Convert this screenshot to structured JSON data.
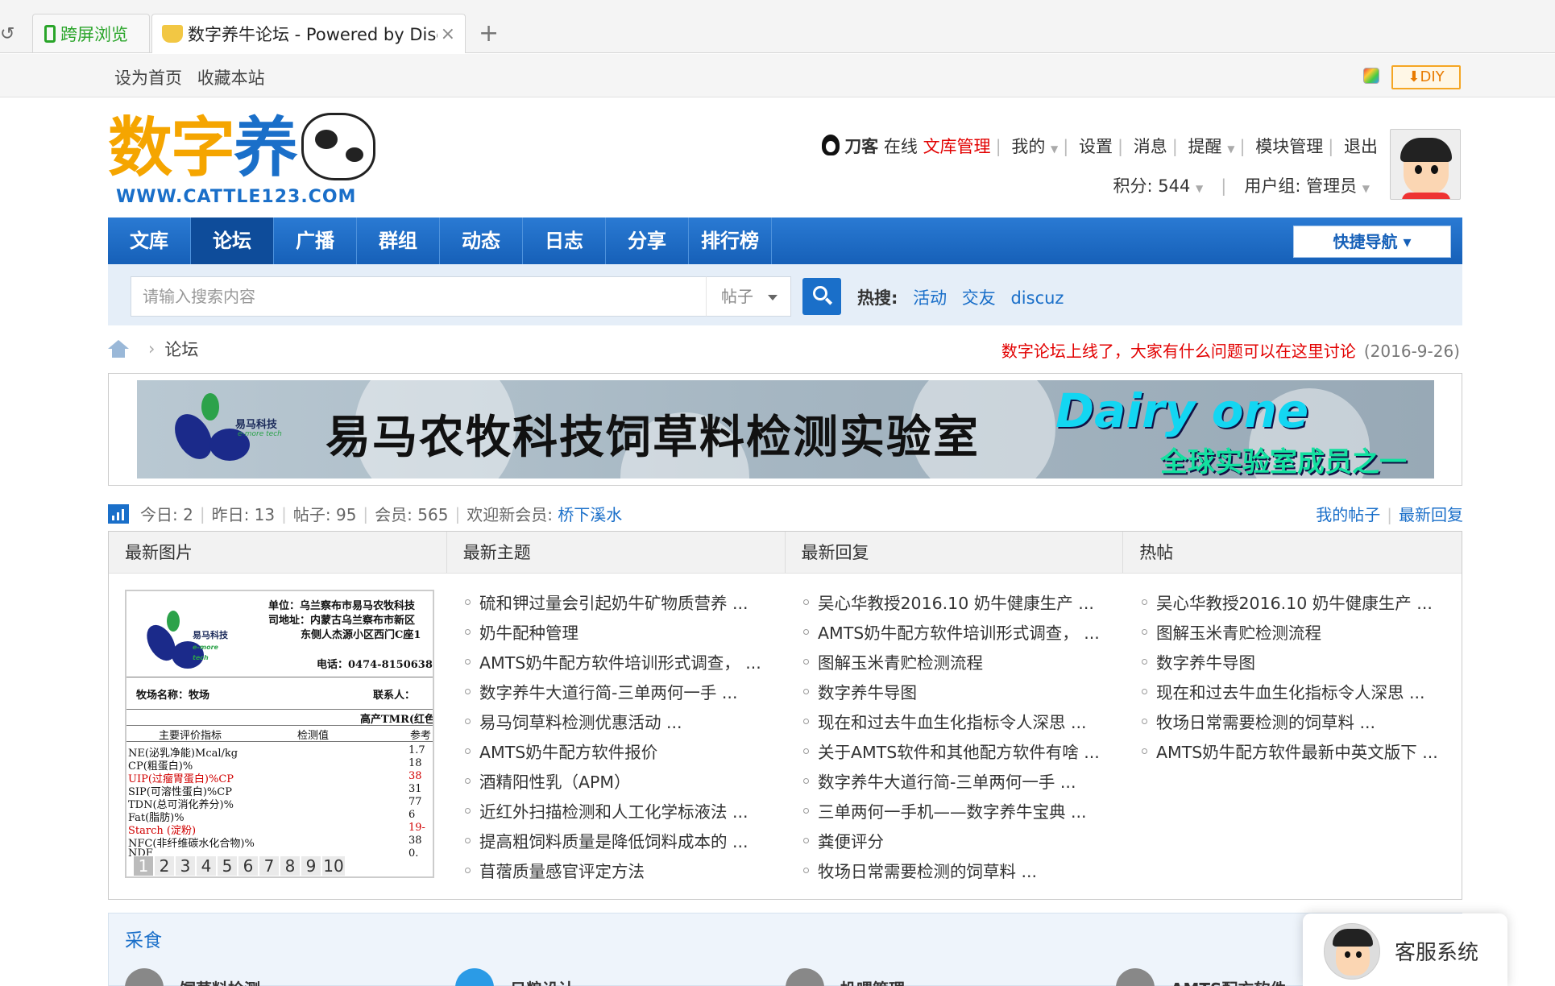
{
  "browser": {
    "tabs": [
      {
        "label": "跨屏浏览"
      },
      {
        "label": "数字养牛论坛 - Powered by Discuz!"
      }
    ]
  },
  "topbar": {
    "links": [
      "设为首页",
      "收藏本站"
    ],
    "diy": "DIY"
  },
  "logo": {
    "text1": "数字",
    "text2": "养",
    "url": "WWW.CATTLE123.COM"
  },
  "usernav": {
    "username": "刀客",
    "status": "在线",
    "items": [
      "文库管理",
      "我的",
      "设置",
      "消息",
      "提醒",
      "模块管理",
      "退出"
    ],
    "points_label": "积分: 544",
    "group_label": "用户组: 管理员"
  },
  "mainnav": {
    "items": [
      "文库",
      "论坛",
      "广播",
      "群组",
      "动态",
      "日志",
      "分享",
      "排行榜"
    ],
    "active": "论坛",
    "quicknav": "快捷导航"
  },
  "search": {
    "placeholder": "请输入搜索内容",
    "type": "帖子",
    "hot_label": "热搜:",
    "hot_keywords": [
      "活动",
      "交友",
      "discuz"
    ]
  },
  "breadcrumb": {
    "current": "论坛"
  },
  "notice": {
    "message": "数字论坛上线了，大家有什么问题可以在这里讨论",
    "date": "(2016-9-26)"
  },
  "banner": {
    "brand_small": "易马科技",
    "brand_tag": "e-more tech",
    "title": "易马农牧科技饲草料检测实验室",
    "dairy": "Dairy one",
    "sub": "全球实验室成员之一"
  },
  "stats": {
    "today": "今日: 2",
    "yesterday": "昨日: 13",
    "posts": "帖子: 95",
    "members": "会员: 565",
    "welcome": "欢迎新会员:",
    "new_member": "桥下溪水",
    "my_posts": "我的帖子",
    "latest_reply": "最新回复"
  },
  "columns": {
    "headers": [
      "最新图片",
      "最新主题",
      "最新回复",
      "热帖"
    ],
    "latest_topics": [
      "硫和钾过量会引起奶牛矿物质营养 ...",
      "奶牛配种管理",
      "AMTS奶牛配方软件培训形式调查， ...",
      "数字养牛大道行简-三单两何一手 ...",
      "易马饲草料检测优惠活动 ...",
      "AMTS奶牛配方软件报价",
      "酒精阳性乳（APM）",
      "近红外扫描检测和人工化学标液法 ...",
      "提高粗饲料质量是降低饲料成本的 ...",
      "苜蓿质量感官评定方法"
    ],
    "latest_replies": [
      "吴心华教授2016.10 奶牛健康生产 ...",
      "AMTS奶牛配方软件培训形式调查， ...",
      "图解玉米青贮检测流程",
      "数字养牛导图",
      "现在和过去牛血生化指标令人深思 ...",
      "关于AMTS软件和其他配方软件有啥 ...",
      "数字养牛大道行简-三单两何一手 ...",
      "三单两何一手机——数字养牛宝典 ...",
      "粪便评分",
      "牧场日常需要检测的饲草料 ..."
    ],
    "hot_posts": [
      "吴心华教授2016.10 奶牛健康生产 ...",
      "图解玉米青贮检测流程",
      "数字养牛导图",
      "现在和过去牛血生化指标令人深思 ...",
      "牧场日常需要检测的饲草料 ...",
      "AMTS奶牛配方软件最新中英文版下 ..."
    ]
  },
  "slide": {
    "brand": "易马科技",
    "brand_tag": "e-more tech",
    "unit": "单位：乌兰察布市易马农牧科技",
    "address": "司地址：内蒙古乌兰察布市新区",
    "address2": "东侧人杰源小区西门C座1",
    "tel": "电话：0474-8150638",
    "farm_name": "牧场名称：牧场",
    "contact": "联系人：",
    "tmr": "高产TMR(红色",
    "col_index": "主要评价指标",
    "col_value": "检测值",
    "col_ref": "参考",
    "rows": [
      {
        "name": "NE(泌乳净能)Mcal/kg",
        "ref": "1.7"
      },
      {
        "name": "CP(粗蛋白)%",
        "ref": "18"
      },
      {
        "name": "UIP(过瘤胃蛋白)%CP",
        "ref": "38"
      },
      {
        "name": "SIP(可溶性蛋白)%CP",
        "ref": "31"
      },
      {
        "name": "TDN(总可消化养分)%",
        "ref": "77"
      },
      {
        "name": "Fat(脂肪)%",
        "ref": "6"
      },
      {
        "name": "Starch (淀粉)",
        "ref": "19-"
      },
      {
        "name": "NFC(非纤维碳水化合物)%",
        "ref": "38"
      },
      {
        "name": "NDF",
        "ref": "0."
      }
    ],
    "pager": [
      "1",
      "2",
      "3",
      "4",
      "5",
      "6",
      "7",
      "8",
      "9",
      "10"
    ],
    "pager_current": "1"
  },
  "section": {
    "title": "采食",
    "items": [
      "饲草料检测",
      "日粮设计",
      "投喂管理",
      "AMTS配方软件"
    ]
  },
  "kefu": {
    "label": "客服系统"
  },
  "colors": {
    "nav_blue": "#1a6fc9",
    "accent_red": "#e20000",
    "diy_orange": "#f5a623"
  }
}
